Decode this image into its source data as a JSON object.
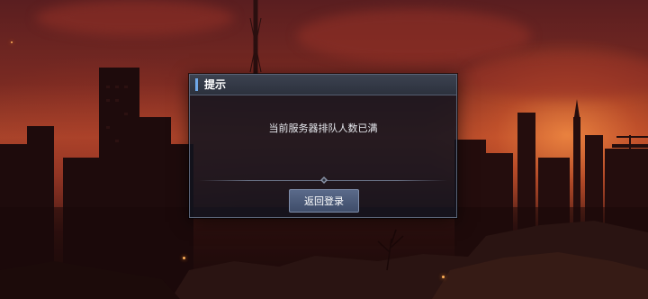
{
  "dialog": {
    "title": "提示",
    "message": "当前服务器排队人数已满",
    "button_label": "返回登录"
  }
}
